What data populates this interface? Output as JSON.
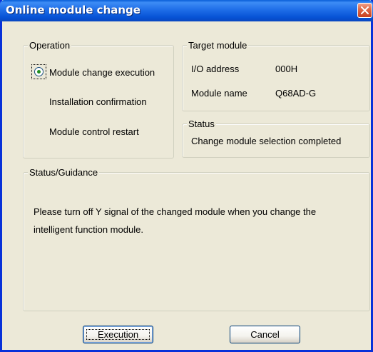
{
  "window": {
    "title": "Online module change"
  },
  "operation": {
    "legend": "Operation",
    "items": [
      {
        "label": "Module change execution",
        "selected": true
      },
      {
        "label": "Installation confirmation"
      },
      {
        "label": "Module control restart"
      }
    ]
  },
  "target_module": {
    "legend": "Target module",
    "io_address_label": "I/O address",
    "io_address_value": "000H",
    "module_name_label": "Module name",
    "module_name_value": "Q68AD-G"
  },
  "status": {
    "legend": "Status",
    "text": "Change module selection completed"
  },
  "guidance": {
    "legend": "Status/Guidance",
    "line1": "Please turn off Y signal of the changed module when you change the",
    "line2": "intelligent function module."
  },
  "buttons": {
    "execution": "Execution",
    "cancel": "Cancel"
  },
  "colors": {
    "titlebar": "#0753d6",
    "dialog_bg": "#ece9d8",
    "close": "#c6401f"
  }
}
